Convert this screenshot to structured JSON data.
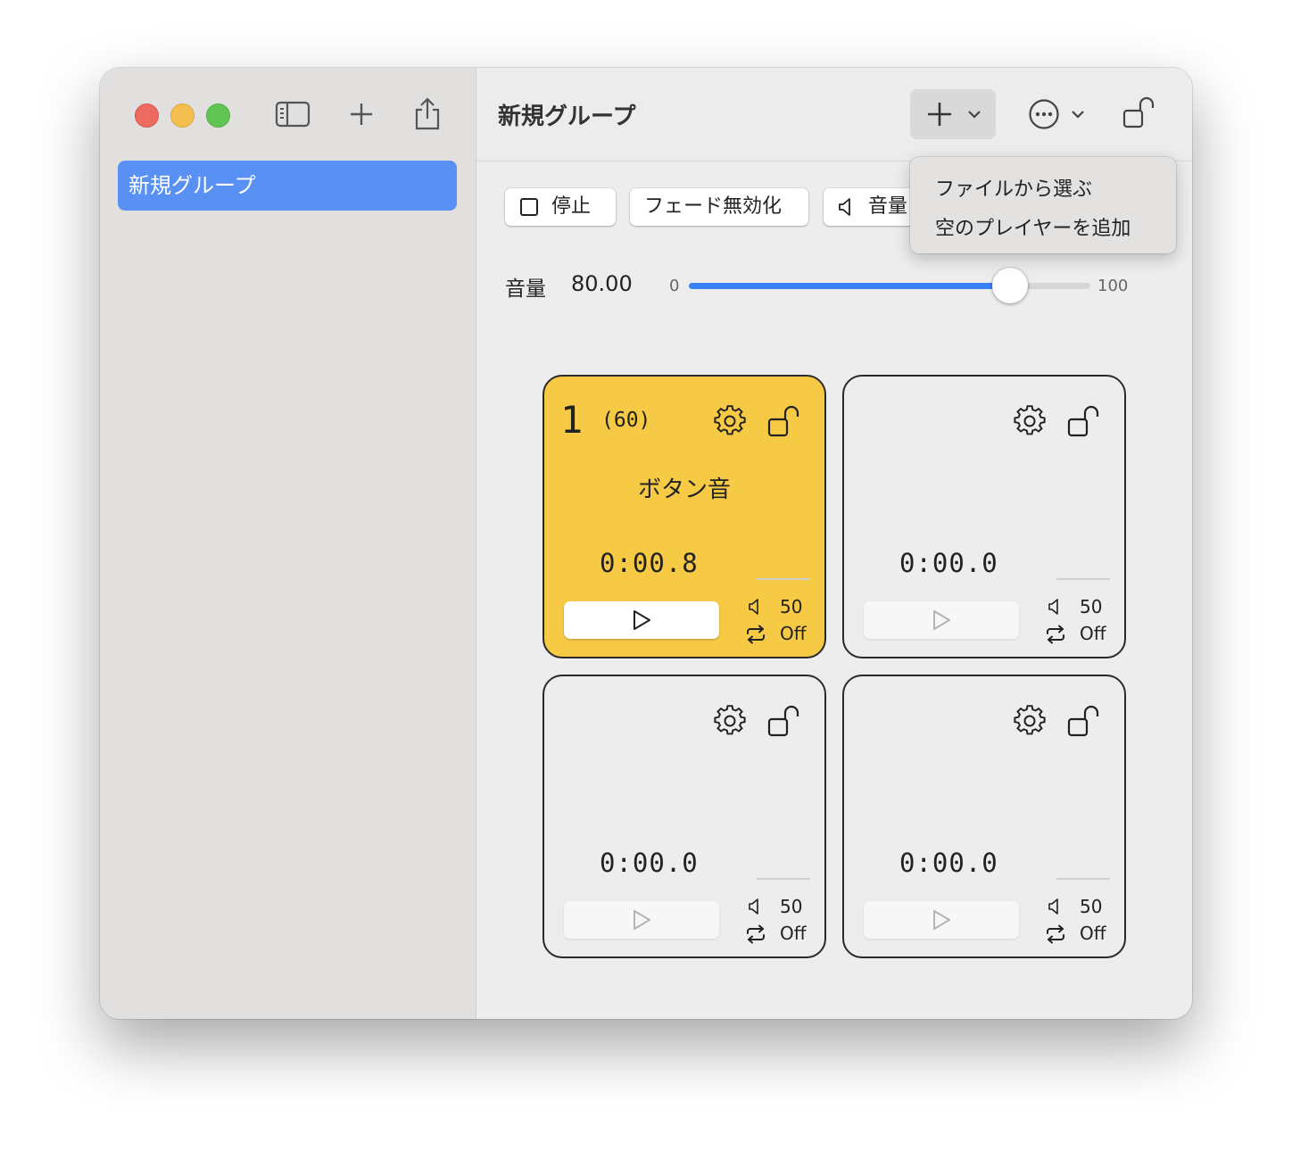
{
  "sidebar": {
    "items": [
      {
        "label": "新規グループ",
        "selected": true
      }
    ]
  },
  "toolbar": {
    "title": "新規グループ"
  },
  "add_menu": {
    "items": [
      "ファイルから選ぶ",
      "空のプレイヤーを追加"
    ]
  },
  "controls": {
    "stop_label": "停止",
    "fade_label": "フェード無効化",
    "volume_chip_label": "音量"
  },
  "volume": {
    "label": "音量",
    "value_text": "80.00",
    "value": 80,
    "min": "0",
    "max": "100"
  },
  "pads": [
    {
      "number": "1",
      "count": "(60)",
      "name": "ボタン音",
      "time": "0:00.8",
      "volume": "50",
      "loop": "Off",
      "active": true
    },
    {
      "number": "",
      "count": "",
      "name": "",
      "time": "0:00.0",
      "volume": "50",
      "loop": "Off",
      "active": false
    },
    {
      "number": "",
      "count": "",
      "name": "",
      "time": "0:00.0",
      "volume": "50",
      "loop": "Off",
      "active": false
    },
    {
      "number": "",
      "count": "",
      "name": "",
      "time": "0:00.0",
      "volume": "50",
      "loop": "Off",
      "active": false
    }
  ],
  "colors": {
    "accent": "#5890f3",
    "slider": "#3a82f6",
    "active_pad": "#f7ca45"
  }
}
